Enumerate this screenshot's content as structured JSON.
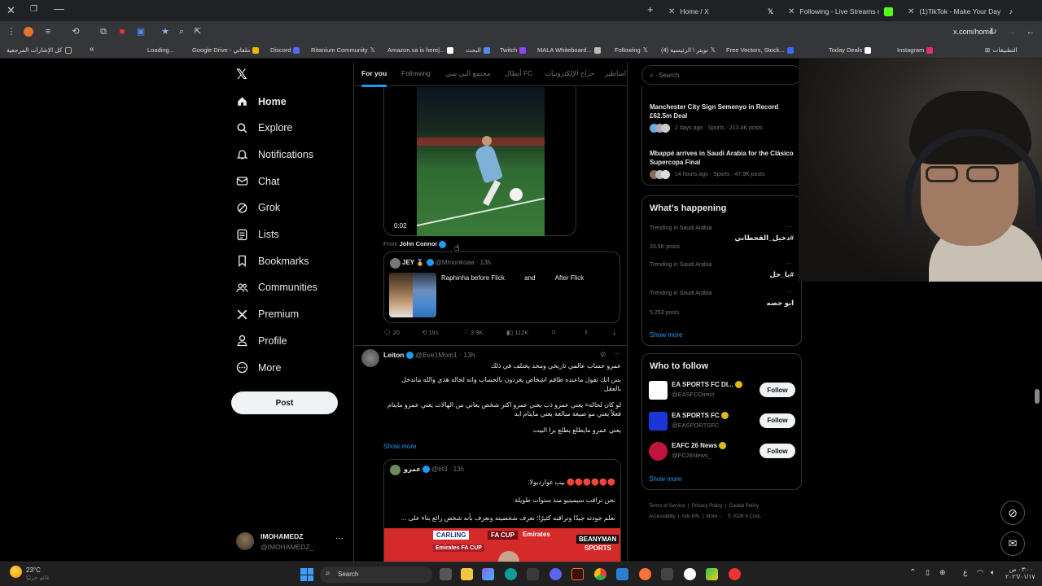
{
  "browser": {
    "tabs": [
      {
        "title": "Home / X",
        "active": true
      },
      {
        "title": "Following - Live Streams on Kick",
        "active": false
      },
      {
        "title": "(1)TikTok - Make Your Day",
        "active": false
      }
    ],
    "url": "x.com/home",
    "bookmarks_left": [
      "كل الإشارات المرجعية",
      "Loading...",
      "Google Drive - ملفاتي",
      "Discord",
      "Ritanium Community",
      "Amazon.sa is here|...",
      "البحث",
      "Twitch",
      "MALA Whiteboard...",
      "Following",
      "(4) تويتر \\ الرئيسية",
      "Free Vectors, Stock...",
      "Today Deals",
      "Instagram",
      "التطبيقات"
    ]
  },
  "nav": {
    "items": [
      {
        "label": "Home",
        "icon": "home-icon"
      },
      {
        "label": "Explore",
        "icon": "search-icon"
      },
      {
        "label": "Notifications",
        "icon": "bell-icon"
      },
      {
        "label": "Chat",
        "icon": "mail-icon"
      },
      {
        "label": "Grok",
        "icon": "grok-icon"
      },
      {
        "label": "Lists",
        "icon": "list-icon"
      },
      {
        "label": "Bookmarks",
        "icon": "bookmark-icon"
      },
      {
        "label": "Communities",
        "icon": "people-icon"
      },
      {
        "label": "Premium",
        "icon": "x-icon"
      },
      {
        "label": "Profile",
        "icon": "person-icon"
      },
      {
        "label": "More",
        "icon": "more-icon"
      }
    ],
    "post_label": "Post",
    "account": {
      "name": "IMOHAMEDZ",
      "handle": "@IMOHAMEDZ_"
    }
  },
  "feed": {
    "tabs": [
      "For you",
      "Following",
      "مجتمع البي سي",
      "أبطال FC",
      "حراج الإلكترونيات",
      "اساطير"
    ],
    "video": {
      "time": "0:02",
      "from_label": "From",
      "from_name": "John Connor"
    },
    "quote": {
      "name": "JEY",
      "handle": "@Mmonkoaa",
      "time": "13h",
      "text1": "Raphinha before Flick",
      "text2": "and",
      "text3": "After Flick"
    },
    "actions": {
      "replies": "20",
      "reposts": "191",
      "likes": "3.9K",
      "views": "112K"
    },
    "post2": {
      "name": "Leiton",
      "handle": "@Eve1Mom1",
      "time": "13h",
      "lines": [
        "عمرو حساب عالمي تاريخي ومحد يختلف في ذلك",
        "بس انك تقول ماعنده طاقم اشخاص يغردون بالحساب وانه لحاله هذي والله ماتدخل بالعقل",
        "لو كان لحاله= يعني عمرو ذب يعني عمرو اكثر شخص يعاني من الهالات يعني عمرو مايتام فعلاً يعني مو صيغة مبالغة يعني مايتام ابد",
        "يعني عمرو مايطلع يطلع برا البيت"
      ],
      "show_more": "Show more"
    },
    "post3": {
      "name": "عمرو",
      "handle": "@bt3",
      "time": "13h",
      "lines": [
        "🔴🔴🔴🔴🔴🔴 بيب غواردیولا:",
        "نحن نراقب سيمينيو منذ سنوات طويلة.",
        "نعلم جودته جيدًا ونراقبه كثيرًا؛ نعرف شخصيته ونعرف بأنه شخص رائع بناء على ..."
      ],
      "image_words": [
        "CARLING",
        "FA CUP",
        "Emirates",
        "BEANYMAN",
        "SPORTS",
        "Emirates FA CUP"
      ]
    }
  },
  "right": {
    "search_placeholder": "Search",
    "news": [
      {
        "title": "Manchester City Sign Semenyo in Record £62.5m Deal",
        "meta": "2 days ago · Sports · 213.4K posts"
      },
      {
        "title": "Mbappé arrives in Saudi Arabia for the Clásico Supercopa Final",
        "meta": "14 hours ago · Sports · 47.9K posts"
      }
    ],
    "whats_happening": {
      "title": "What’s happening",
      "trends": [
        {
          "context": "Trending in Saudi Arabia",
          "tag": "#دخيل_القحطاني",
          "count": "33.5K posts"
        },
        {
          "context": "Trending in Saudi Arabia",
          "tag": "#يا_حل",
          "count": ""
        },
        {
          "context": "Trending in Saudi Arabia",
          "tag": "ابو حصه",
          "count": "5,253 posts"
        }
      ],
      "show_more": "Show more"
    },
    "who_to_follow": {
      "title": "Who to follow",
      "accounts": [
        {
          "name": "EA SPORTS FC DI...",
          "handle": "@EASFCDirect",
          "color": "#ffffff"
        },
        {
          "name": "EA SPORTS FC",
          "handle": "@EASPORTSFC",
          "color": "#1b36d6"
        },
        {
          "name": "EAFC 26 News",
          "handle": "@FC26News_",
          "color": "#c0163d"
        }
      ],
      "follow_label": "Follow",
      "show_more": "Show more"
    },
    "footer": [
      "Terms of Service",
      "Privacy Policy",
      "Cookie Policy",
      "Accessibility",
      "Ads info",
      "More ···",
      "© 2026 X Corp."
    ]
  },
  "taskbar": {
    "weather": "23°C",
    "weather_sub": "غائم جزئيًا",
    "search": "Search",
    "time": "٠٣:٠٠ ص",
    "date": "٢٠٢٦/٠١/١٧",
    "lang": "ع"
  },
  "colors": {
    "accent": "#1d9bf0",
    "border": "#2f3336",
    "muted": "#71767b"
  }
}
